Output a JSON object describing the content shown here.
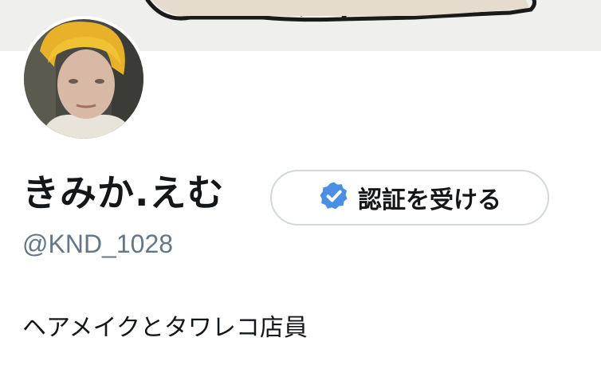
{
  "profile": {
    "display_name": "きみか.えむ",
    "handle": "@KND_1028",
    "bio": "ヘアメイクとタワレコ店員",
    "verify_button_label": "認証を受ける",
    "verify_icon": "verified-badge-icon"
  },
  "colors": {
    "text_primary": "#14171a",
    "text_secondary": "#657786",
    "verified_blue": "#4a90e2",
    "button_border": "#cfd9de",
    "banner_bg": "#efefed"
  }
}
